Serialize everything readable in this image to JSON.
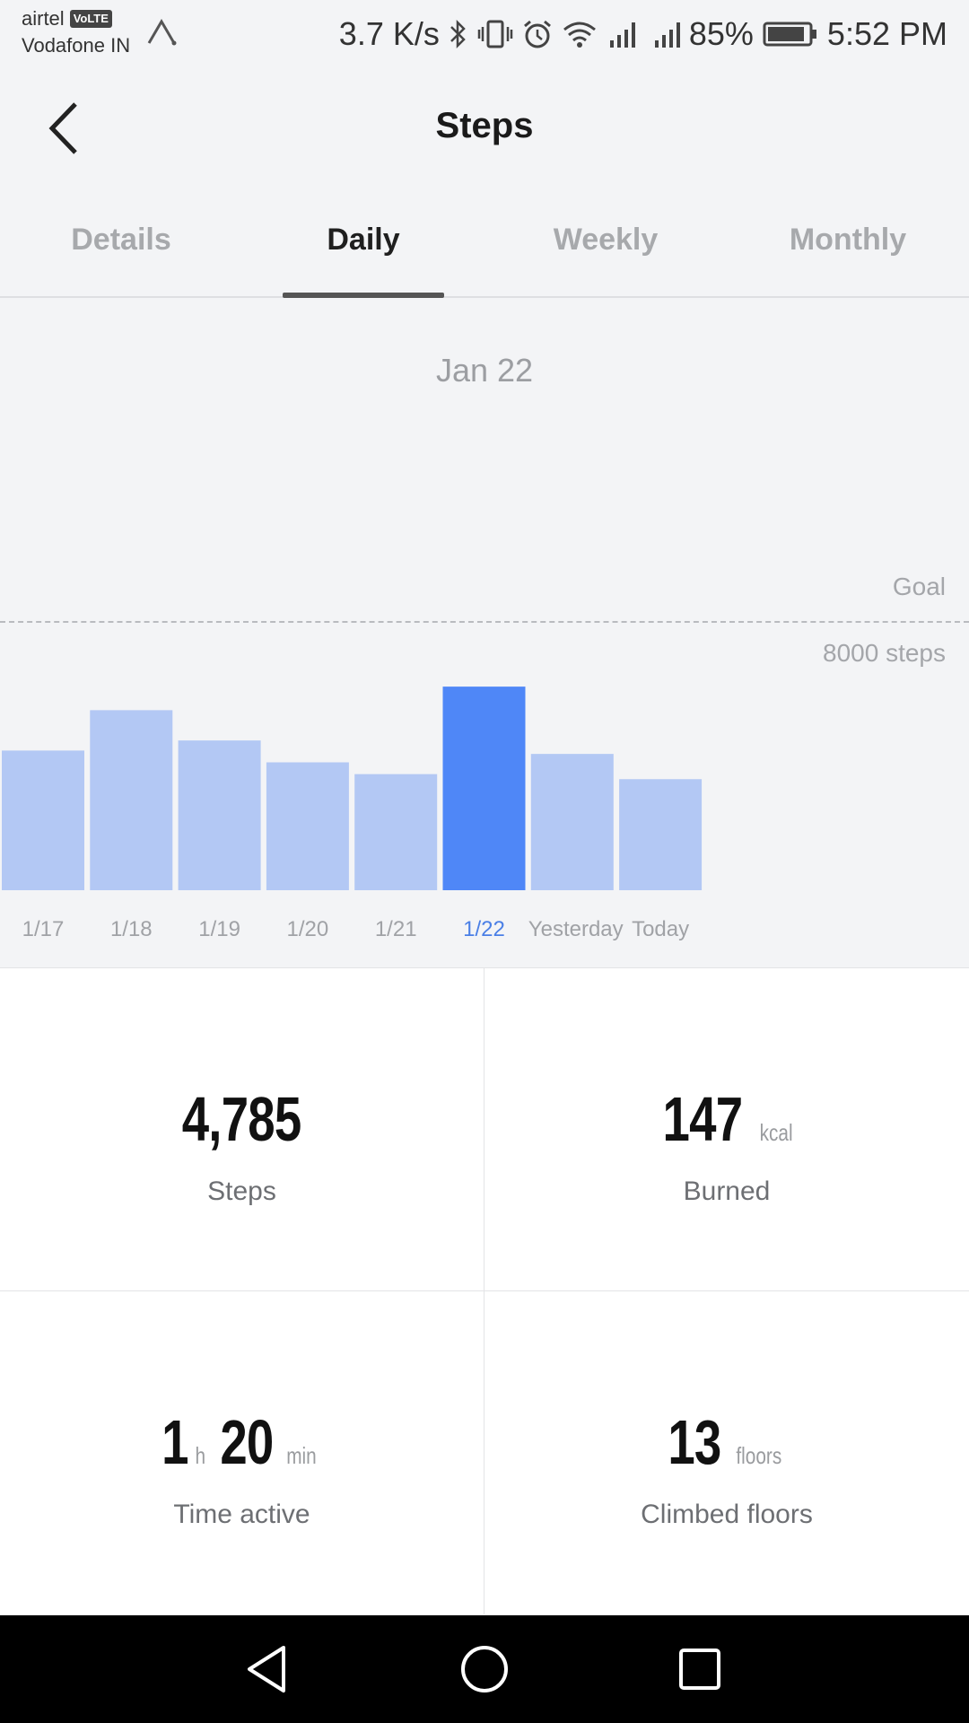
{
  "status_bar": {
    "carrier1": "airtel",
    "volte": "VoLTE",
    "carrier2": "Vodafone IN",
    "speed": "3.7 K/s",
    "battery": "85%",
    "time": "5:52 PM",
    "icons": [
      "bluetooth-icon",
      "vibrate-icon",
      "alarm-icon",
      "wifi-icon",
      "signal-icon",
      "battery-icon"
    ]
  },
  "header": {
    "title": "Steps"
  },
  "tabs": [
    {
      "label": "Details",
      "active": false
    },
    {
      "label": "Daily",
      "active": true
    },
    {
      "label": "Weekly",
      "active": false
    },
    {
      "label": "Monthly",
      "active": false
    }
  ],
  "chart": {
    "date": "Jan 22",
    "goal_label": "Goal",
    "goal_value": "8000 steps"
  },
  "chart_data": {
    "type": "bar",
    "categories": [
      "1/17",
      "1/18",
      "1/19",
      "1/20",
      "1/21",
      "1/22",
      "Yesterday",
      "Today"
    ],
    "values": [
      4150,
      5350,
      4450,
      3800,
      3450,
      6050,
      4050,
      3300
    ],
    "selected_index": 5,
    "goal": 8000,
    "ylim": [
      0,
      8000
    ],
    "colors": {
      "bar": "#b3c8f4",
      "selected": "#4f87f7"
    }
  },
  "stats": {
    "steps": {
      "value": "4,785",
      "label": "Steps"
    },
    "burned": {
      "value": "147",
      "unit": "kcal",
      "label": "Burned"
    },
    "time_active": {
      "hours": "1",
      "hours_unit": "h",
      "minutes": "20",
      "minutes_unit": "min",
      "label": "Time active"
    },
    "floors": {
      "value": "13",
      "unit": "floors",
      "label": "Climbed floors"
    }
  },
  "nav": [
    "back-nav-icon",
    "home-nav-icon",
    "recents-nav-icon"
  ]
}
